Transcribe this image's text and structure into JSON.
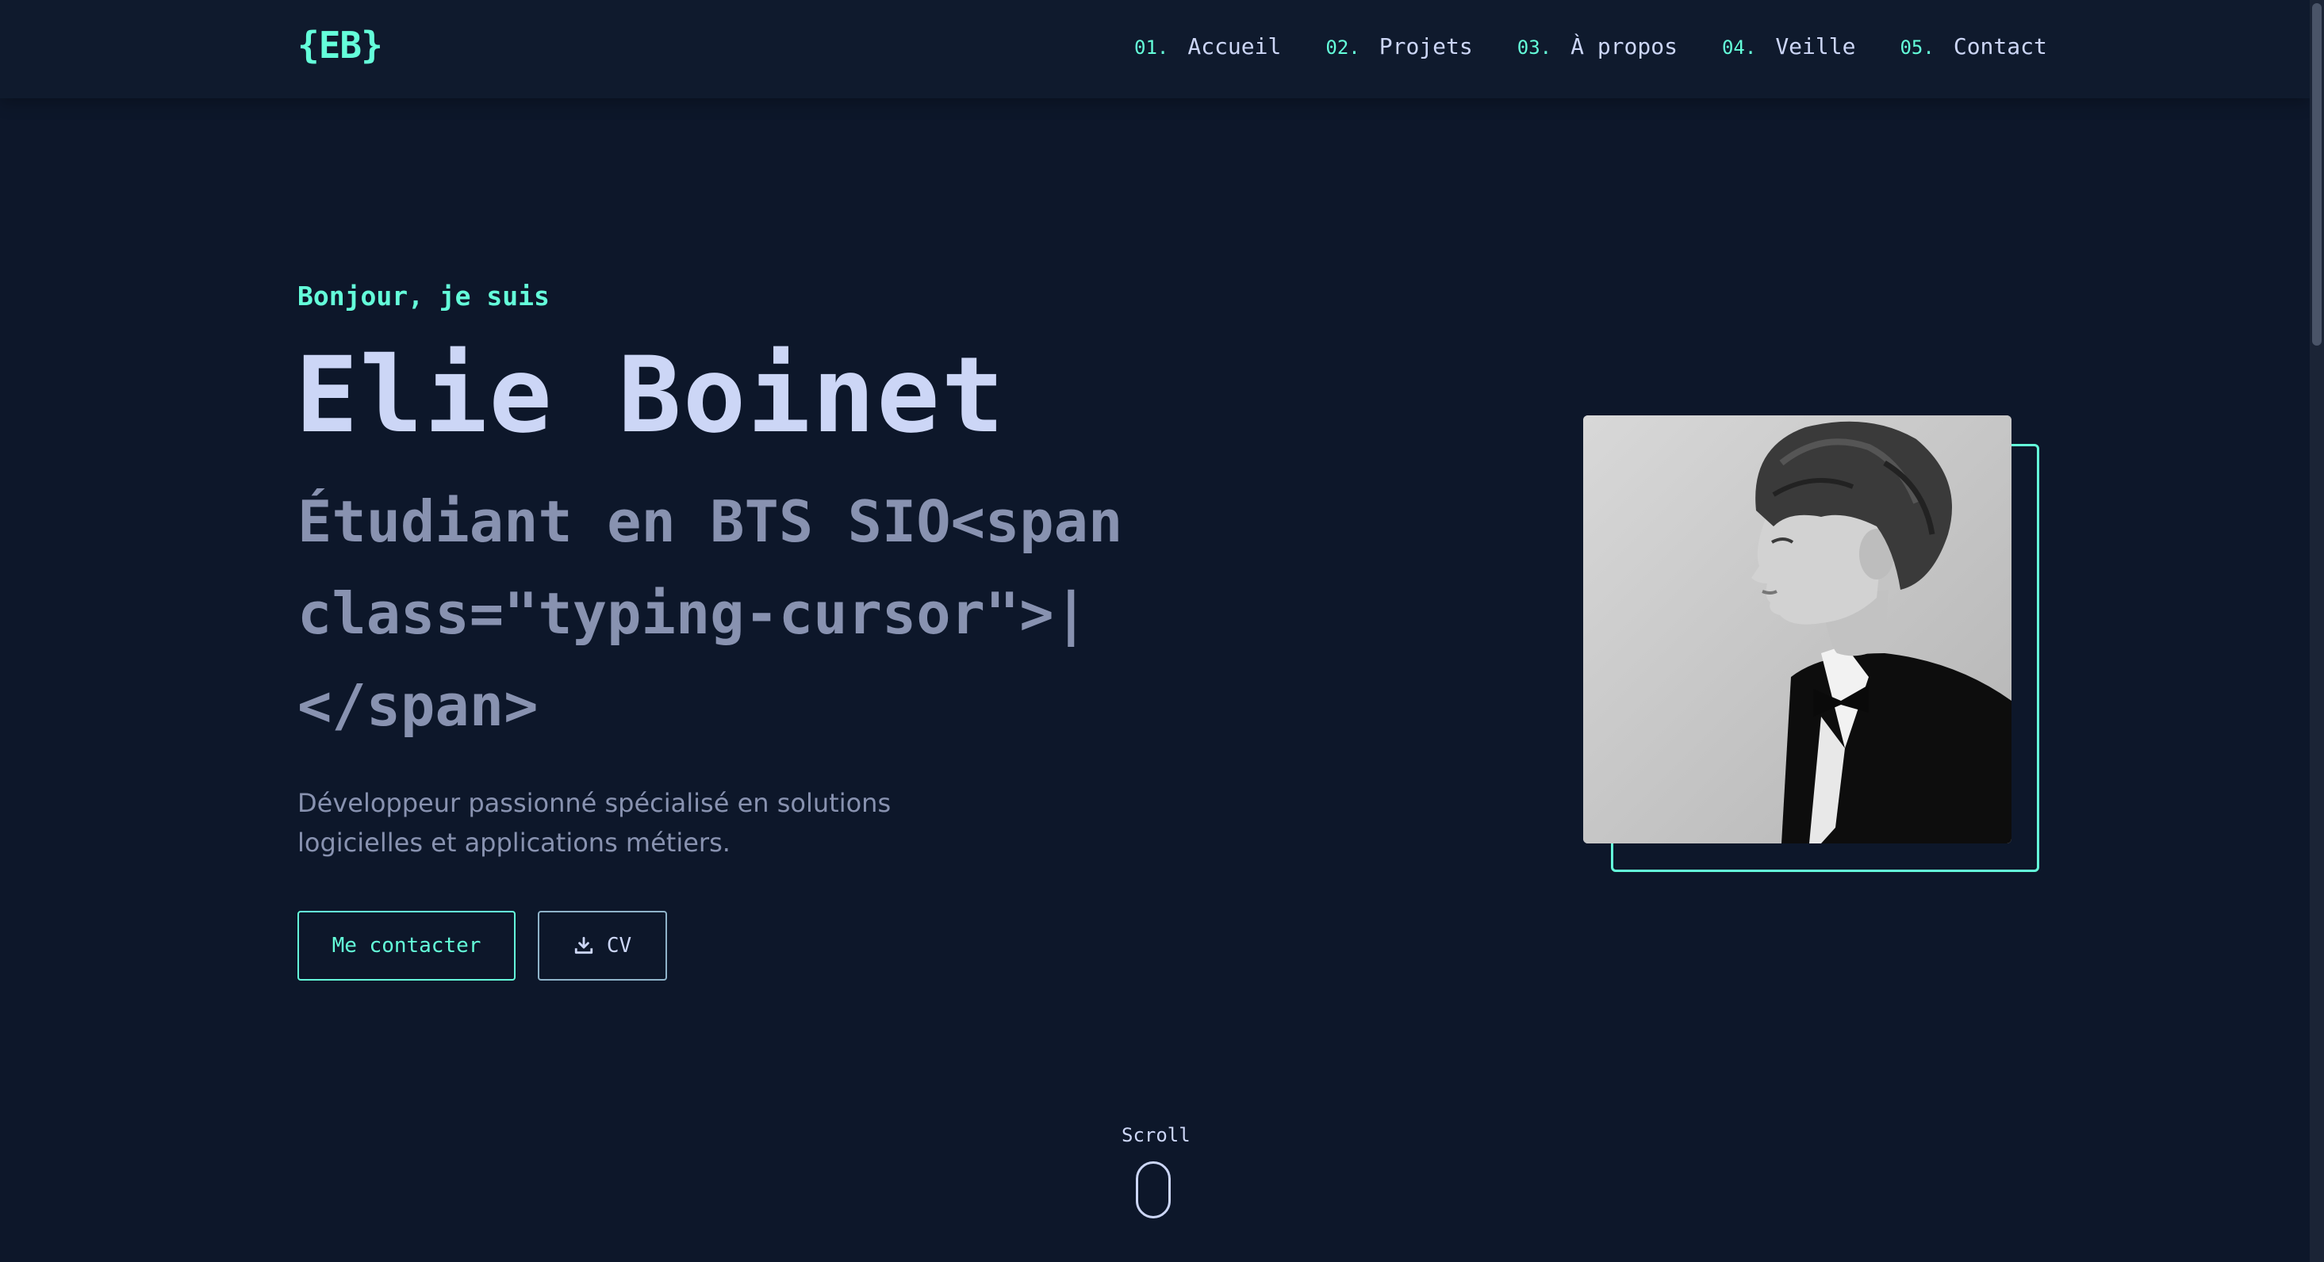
{
  "header": {
    "logo": "{EB}",
    "nav": [
      {
        "num": "01.",
        "label": "Accueil"
      },
      {
        "num": "02.",
        "label": "Projets"
      },
      {
        "num": "03.",
        "label": "À propos"
      },
      {
        "num": "04.",
        "label": "Veille"
      },
      {
        "num": "05.",
        "label": "Contact"
      }
    ]
  },
  "hero": {
    "greeting": "Bonjour, je suis",
    "name": "Elie Boinet",
    "role": "Étudiant en BTS SIO<span class=\"typing-cursor\">|</span>",
    "description": "Développeur passionné spécialisé en solutions logicielles et applications métiers.",
    "contact_button": "Me contacter",
    "cv_button": "CV"
  },
  "scroll": {
    "label": "Scroll"
  },
  "colors": {
    "background": "#0d172a",
    "accent": "#64ffda",
    "heading": "#ccd6f6",
    "muted": "#8892b0"
  },
  "icons": {
    "cv_button_icon": "download-icon"
  }
}
